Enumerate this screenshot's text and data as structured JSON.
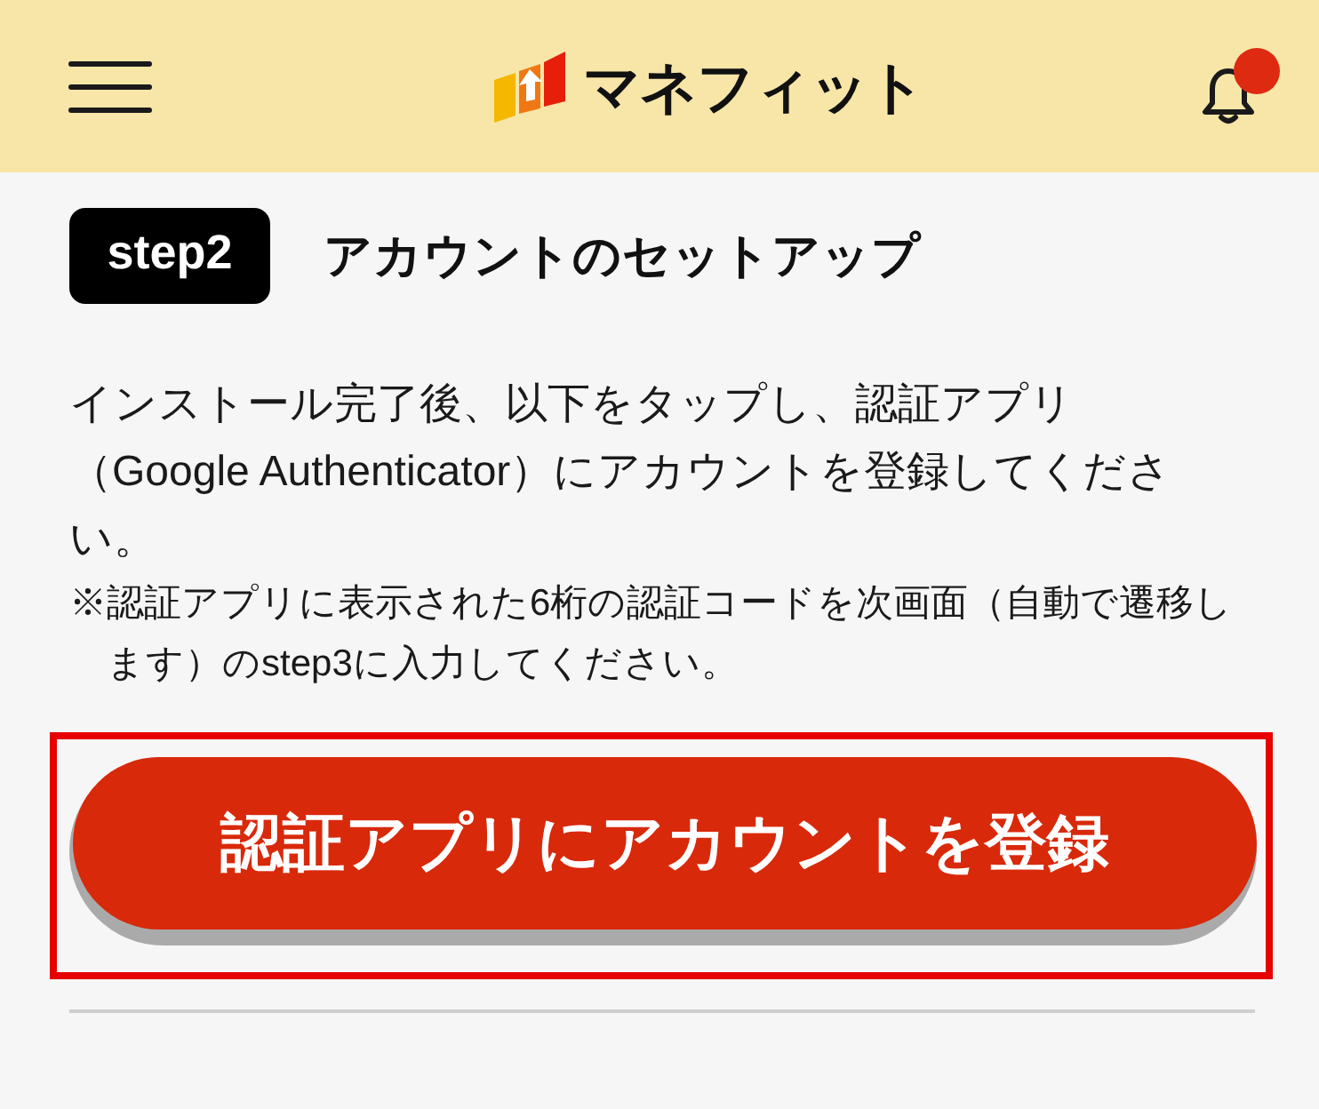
{
  "header": {
    "logo_text": "マネフィット",
    "notifications": {
      "unread": true
    }
  },
  "step": {
    "badge": "step2",
    "title": "アカウントのセットアップ"
  },
  "instructions": "インストール完了後、以下をタップし、認証アプリ（Google Authenticator）にアカウントを登録してください。",
  "note": "※認証アプリに表示された6桁の認証コードを次画面（自動で遷移します）のstep3に入力してください。",
  "register_button": {
    "label": "認証アプリにアカウントを登録",
    "highlighted": true
  }
}
